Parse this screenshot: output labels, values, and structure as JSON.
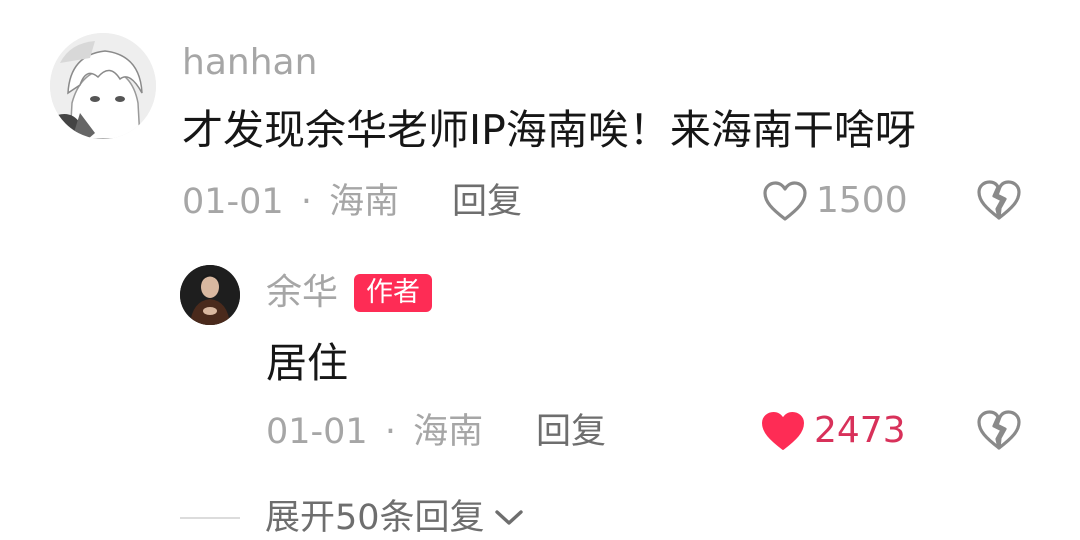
{
  "comments": [
    {
      "username": "hanhan",
      "text": "才发现余华老师IP海南唉！来海南干啥呀",
      "date": "01-01",
      "separator": "·",
      "location": "海南",
      "reply_label": "回复",
      "likes": "1500",
      "liked": false,
      "avatar_icon": "anime-avatar-icon",
      "replies": [
        {
          "username": "余华",
          "badge": "作者",
          "text": "居住",
          "date": "01-01",
          "separator": "·",
          "location": "海南",
          "reply_label": "回复",
          "likes": "2473",
          "liked": true,
          "avatar_icon": "person-avatar-icon"
        }
      ]
    }
  ],
  "expand": {
    "label": "展开50条回复"
  },
  "colors": {
    "muted_text": "#a6a6a6",
    "body_text": "#161616",
    "accent_red": "#fe2c55",
    "liked_count": "#d8315a",
    "icon_gray": "#8a8a8a"
  }
}
